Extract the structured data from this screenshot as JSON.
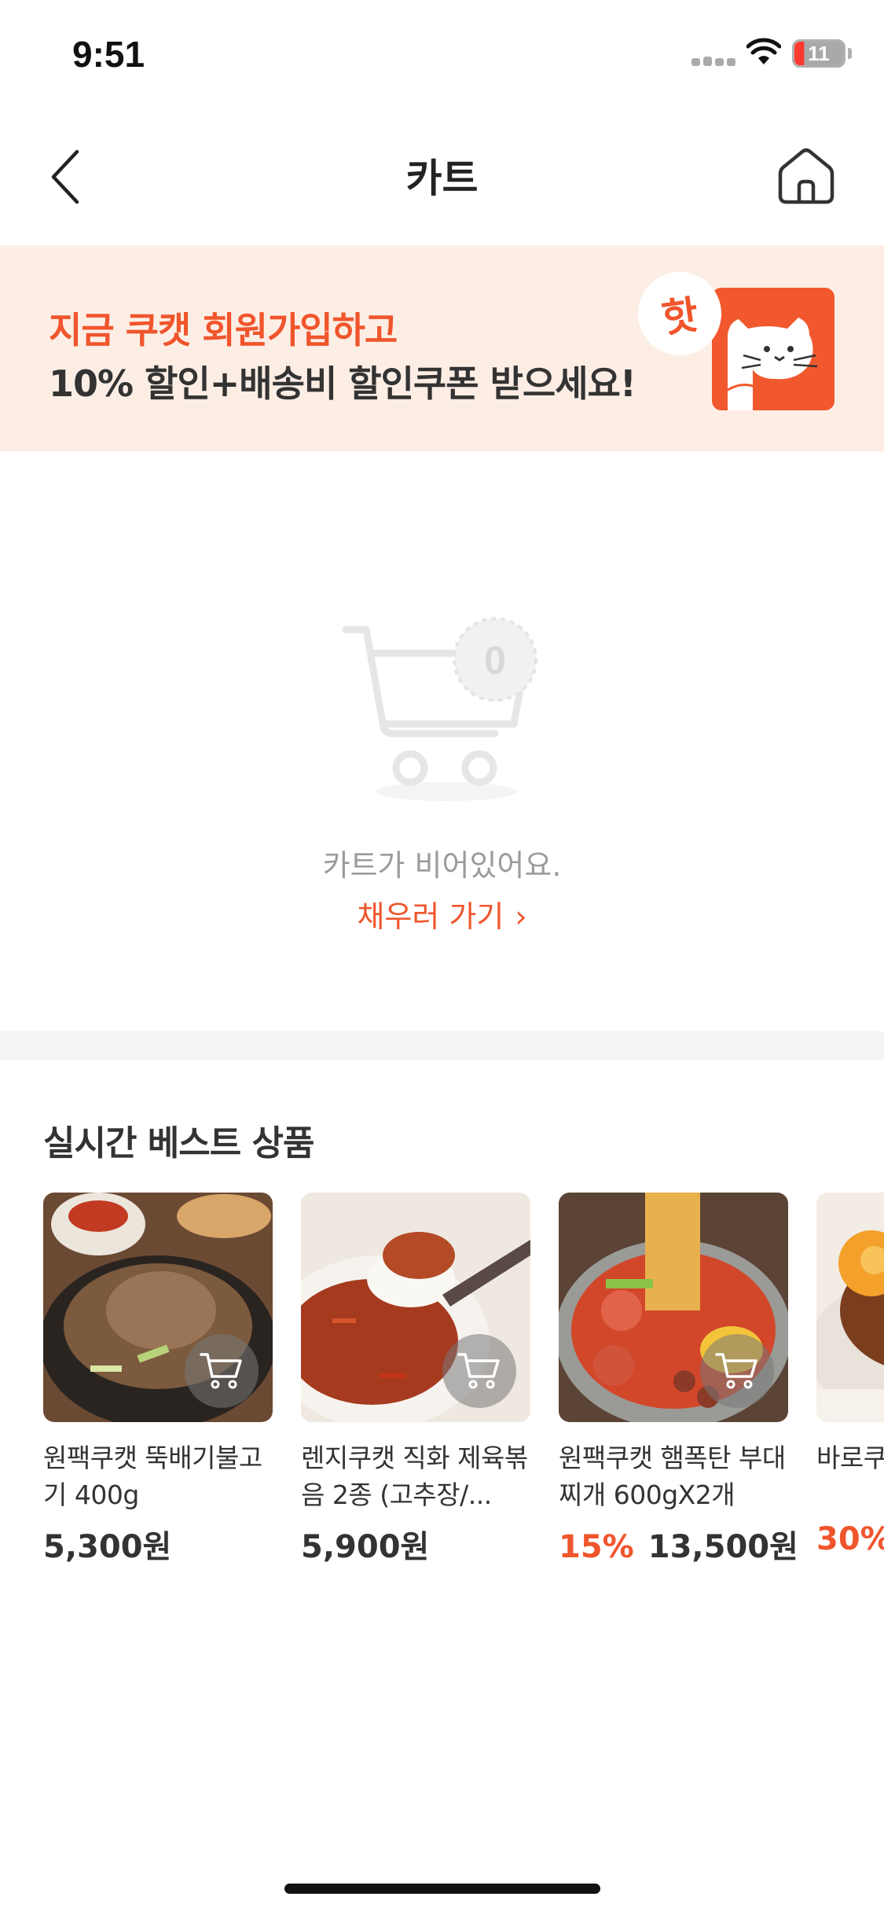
{
  "status_bar": {
    "time": "9:51",
    "battery_level": "11"
  },
  "nav": {
    "title": "카트",
    "back_icon": "chevron-left-icon",
    "home_icon": "home-icon"
  },
  "promo": {
    "line1": "지금 쿠캣 회원가입하고",
    "line2": "10% 할인+배송비 할인쿠폰 받으세요!",
    "badge": "핫"
  },
  "empty_cart": {
    "count": "0",
    "message": "카트가 비어있어요.",
    "fill_link": "채우러 가기",
    "fill_link_chevron": "›"
  },
  "best": {
    "title": "실시간 베스트 상품",
    "products": [
      {
        "name": "원팩쿠캣 뚝배기불고기 400g",
        "discount": "",
        "price": "5,300원"
      },
      {
        "name": "렌지쿠캣 직화 제육볶음 2종 (고추장/...",
        "discount": "",
        "price": "5,900원"
      },
      {
        "name": "원팩쿠캣 햄폭탄 부대찌개 600gX2개",
        "discount": "15%",
        "price": "13,500원"
      },
      {
        "name": "바로쿠 종 (간",
        "discount": "30%",
        "price": ""
      }
    ]
  },
  "colors": {
    "accent": "#f0552c",
    "promo_bg": "#fdeee5",
    "divider": "#f4f4f4"
  }
}
